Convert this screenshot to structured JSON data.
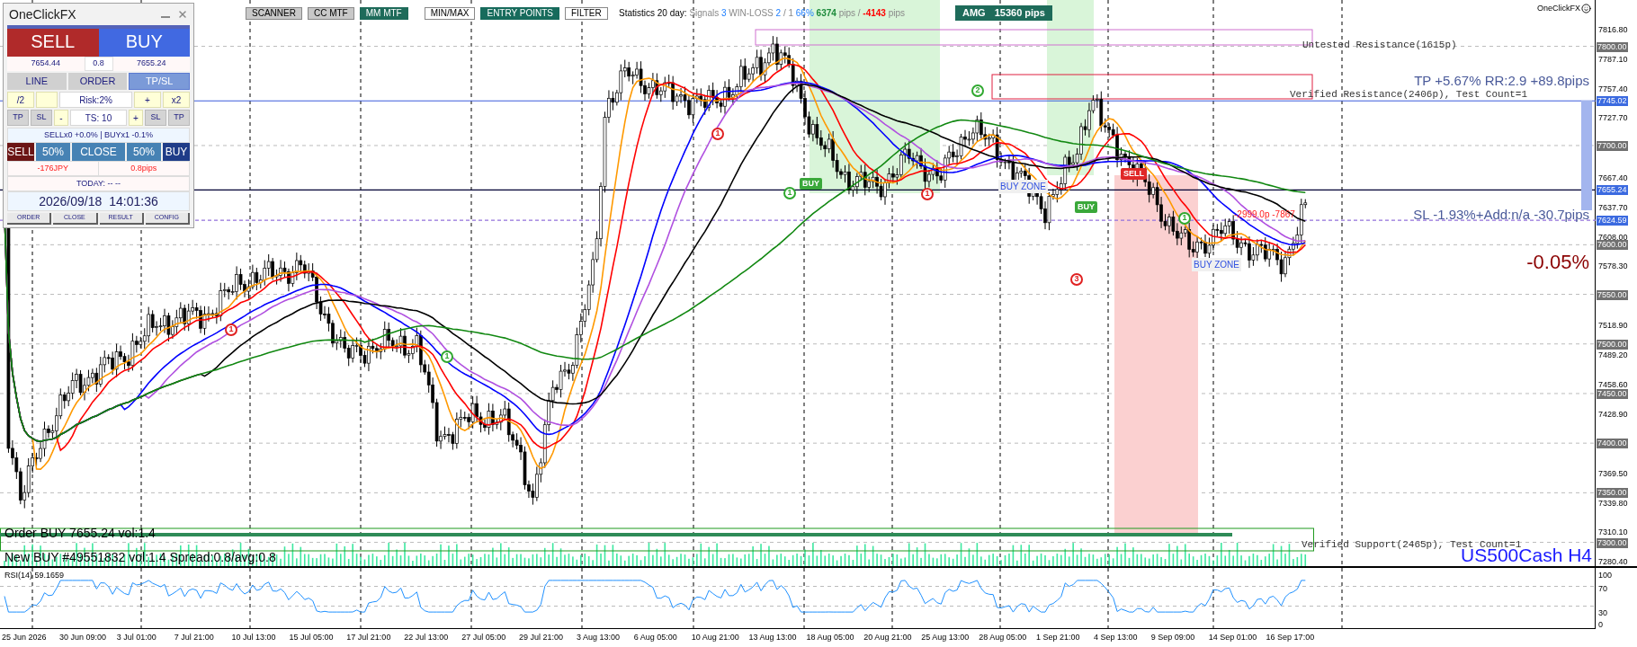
{
  "panel": {
    "title": "OneClickFX",
    "sell_button": "SELL",
    "buy_button": "BUY",
    "lot": "0.8",
    "sell_price": "7654.44",
    "buy_price": "7655.24",
    "modes": [
      {
        "label": "LINE",
        "selected": false
      },
      {
        "label": "ORDER",
        "selected": false
      },
      {
        "label": "TP/SL",
        "selected": true
      }
    ],
    "risk_row": [
      {
        "text": "/2",
        "kind": "yellow"
      },
      {
        "kind": "blank"
      },
      {
        "text": "Risk:2%",
        "kind": "field"
      },
      {
        "text": "+",
        "kind": "yellow"
      },
      {
        "text": "x2",
        "kind": "yellow"
      }
    ],
    "ts_row": [
      {
        "text": "TP",
        "kind": "gray"
      },
      {
        "text": "SL",
        "kind": "gray"
      },
      {
        "text": "-",
        "kind": "yellow"
      },
      {
        "text": "TS: 10",
        "kind": "field"
      },
      {
        "text": "+",
        "kind": "yellow"
      },
      {
        "text": "SL",
        "kind": "gray"
      },
      {
        "text": "TP",
        "kind": "gray"
      }
    ],
    "positions": "SELLx0 +0.0% | BUYx1 -0.1%",
    "close_row": [
      {
        "text": "SELL",
        "kind": "sell"
      },
      {
        "text": "50%",
        "kind": "half"
      },
      {
        "text": "CLOSE",
        "kind": "close"
      },
      {
        "text": "50%",
        "kind": "half"
      },
      {
        "text": "BUY",
        "kind": "buy"
      }
    ],
    "profit": "-176JPY",
    "spread": "0.8pips",
    "today": "TODAY: -- --",
    "date": "2026/09/18",
    "time": "14:01:36",
    "footer_tabs": [
      "ORDER",
      "CLOSE",
      "RESULT",
      "CONFIG"
    ]
  },
  "toolbar": [
    {
      "label": "SCANNER",
      "kind": "window",
      "selected": false
    },
    {
      "label": "CC MTF",
      "kind": "window",
      "selected": false
    },
    {
      "label": "MM MTF",
      "kind": "window",
      "selected": true
    },
    {
      "label": "MIN/MAX",
      "kind": "filter",
      "selected": false
    },
    {
      "label": "ENTRY POINTS",
      "kind": "filter",
      "selected": true
    },
    {
      "label": "FILTER",
      "kind": "filter",
      "selected": false
    }
  ],
  "statistics": [
    {
      "text": "Statistics 20 day:",
      "kind": "title"
    },
    {
      "text": "Signals",
      "kind": "label"
    },
    {
      "text": "3",
      "kind": "count"
    },
    {
      "text": "WIN-LOSS",
      "kind": "label"
    },
    {
      "text": "2",
      "kind": "count"
    },
    {
      "text": "/ 1",
      "kind": "label"
    },
    {
      "text": "66%",
      "kind": "count"
    },
    {
      "text": "6374",
      "kind": "gain"
    },
    {
      "text": "pips /",
      "kind": "label"
    },
    {
      "text": "-4143",
      "kind": "loss"
    },
    {
      "text": "pips",
      "kind": "label"
    }
  ],
  "amg": {
    "label": "AMG",
    "value": "15360 pips"
  },
  "chart": {
    "brand": "OneClickFX",
    "symbol": "US500Cash H4",
    "zones": [
      "Untested Resistance(1615p)",
      "Verified Resistance(2406p), Test Count=1",
      "Verified Support(2465p), Test Count=1"
    ],
    "tp_text": "TP +5.67% RR:2.9 +89.8pips",
    "sl_text": "SL -1.93%+Add:n/a -30.7pips",
    "change": "-0.05%",
    "order_log": [
      "Order BUY 7655.24 vol:1.4",
      "New BUY #49551832 vol:1.4 Spread:0.8/avg:0.8"
    ],
    "signals": [
      {
        "text": "1",
        "color": "#e02020"
      },
      {
        "text": "1",
        "color": "#2fa82f"
      },
      {
        "text": "1",
        "color": "#e02020"
      },
      {
        "text": "1",
        "color": "#2fa82f"
      },
      {
        "text": "1",
        "color": "#e02020"
      },
      {
        "text": "2",
        "color": "#2fa82f"
      },
      {
        "text": "3",
        "color": "#e02020"
      },
      {
        "text": "1",
        "color": "#2fa82f"
      }
    ],
    "trades": [
      {
        "text": "BUY",
        "kind": "buy"
      },
      {
        "text": "BUY",
        "kind": "buy"
      },
      {
        "text": "SELL",
        "kind": "sell"
      }
    ],
    "zone_labels": [
      "BUY ZONE",
      "BUY ZONE"
    ],
    "loss_note": "-2999.0p -7867"
  },
  "price_axis": {
    "ticks": [
      "7816.80",
      "7787.10",
      "7757.40",
      "7727.70",
      "7667.40",
      "7637.70",
      "7608.00",
      "7578.30",
      "7518.90",
      "7489.20",
      "7458.60",
      "7428.90",
      "7369.50",
      "7339.80",
      "7310.10",
      "7280.40"
    ],
    "levels": [
      "7800.00",
      "7700.00",
      "7600.00",
      "7550.00",
      "7500.00",
      "7450.00",
      "7400.00",
      "7350.00",
      "7300.00"
    ],
    "markers": [
      "7745.02",
      "7655.24",
      "7624.59"
    ]
  },
  "rsi": {
    "label": "RSI(14) 59.1659",
    "ticks": [
      "100",
      "70",
      "30",
      "0"
    ]
  },
  "time_axis": [
    "25 Jun 2026",
    "30 Jun 09:00",
    "3 Jul 01:00",
    "7 Jul 21:00",
    "10 Jul 13:00",
    "15 Jul 05:00",
    "17 Jul 21:00",
    "22 Jul 13:00",
    "27 Jul 05:00",
    "29 Jul 21:00",
    "3 Aug 13:00",
    "6 Aug 05:00",
    "10 Aug 21:00",
    "13 Aug 13:00",
    "18 Aug 05:00",
    "20 Aug 21:00",
    "25 Aug 13:00",
    "28 Aug 05:00",
    "1 Sep 21:00",
    "4 Sep 13:00",
    "9 Sep 09:00",
    "14 Sep 01:00",
    "16 Sep 17:00"
  ]
}
